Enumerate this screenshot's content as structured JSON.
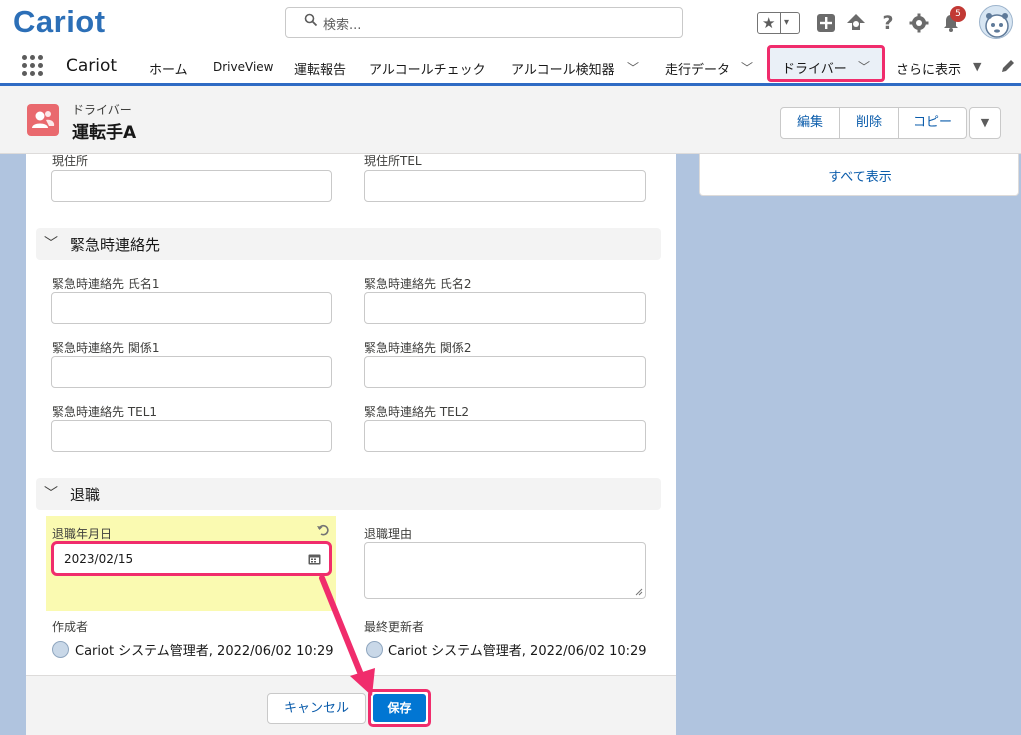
{
  "header": {
    "logo": "Cariot",
    "search_placeholder": "検索...",
    "notification_count": "5"
  },
  "nav": {
    "app_name": "Cariot",
    "items": [
      {
        "label": "ホーム"
      },
      {
        "label": "DriveView"
      },
      {
        "label": "運転報告"
      },
      {
        "label": "アルコールチェック"
      },
      {
        "label": "アルコール検知器"
      },
      {
        "label": "走行データ"
      },
      {
        "label": "ドライバー"
      },
      {
        "label": "さらに表示"
      }
    ]
  },
  "record": {
    "object_label": "ドライバー",
    "name": "運転手A",
    "actions": {
      "edit": "編集",
      "delete": "削除",
      "copy": "コピー"
    }
  },
  "sidebar": {
    "show_all": "すべて表示"
  },
  "form": {
    "address_label": "現住所",
    "address_tel_label": "現住所TEL",
    "emergency_section": "緊急時連絡先",
    "emergency_name1": "緊急時連絡先 氏名1",
    "emergency_name2": "緊急時連絡先 氏名2",
    "emergency_rel1": "緊急時連絡先 関係1",
    "emergency_rel2": "緊急時連絡先 関係2",
    "emergency_tel1": "緊急時連絡先 TEL1",
    "emergency_tel2": "緊急時連絡先 TEL2",
    "retirement_section": "退職",
    "retirement_date_label": "退職年月日",
    "retirement_date_value": "2023/02/15",
    "retirement_reason_label": "退職理由",
    "created_by_label": "作成者",
    "created_by_value": "Cariot システム管理者, 2022/06/02 10:29",
    "modified_by_label": "最終更新者",
    "modified_by_value": "Cariot システム管理者, 2022/06/02 10:29"
  },
  "footer": {
    "cancel": "キャンセル",
    "save": "保存"
  },
  "colors": {
    "brand": "#2c6fb7",
    "highlight": "#f02c6c",
    "primary_button": "#0176d3",
    "changed_field": "#fafab1"
  }
}
